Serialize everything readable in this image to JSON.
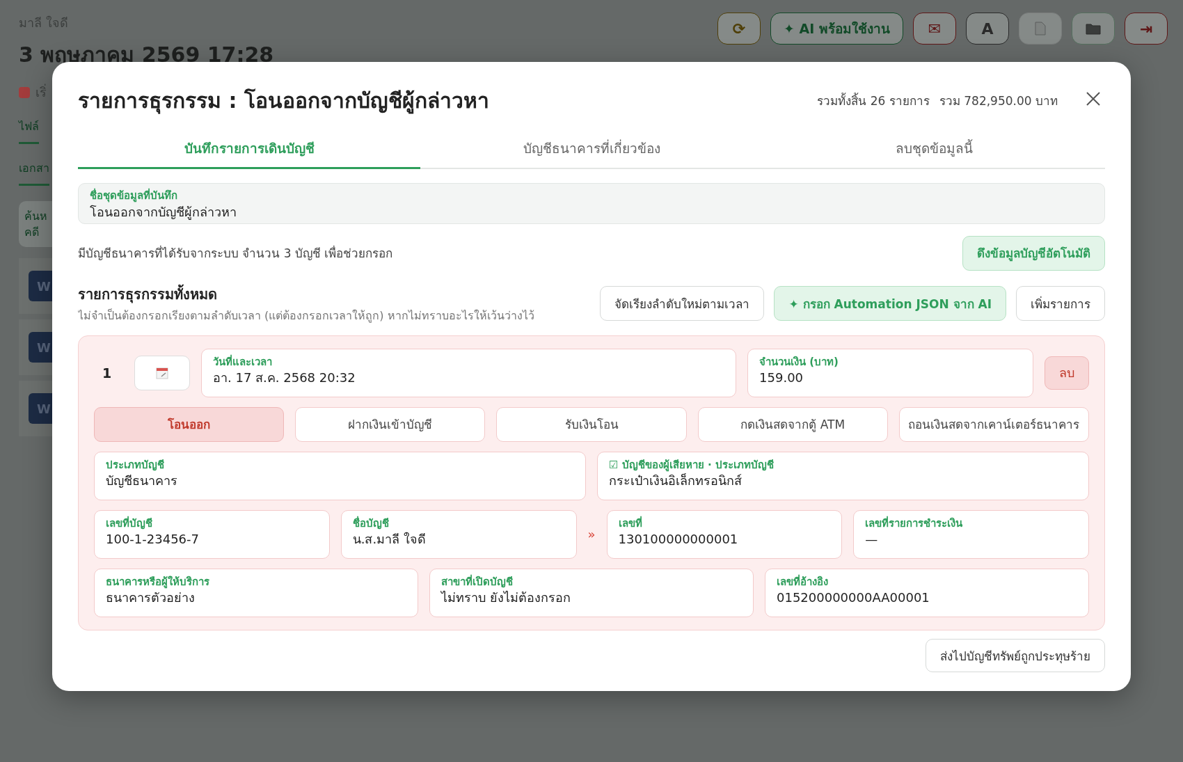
{
  "background": {
    "user_name": "มาลี ใจดี",
    "datetime": "3 พฤษภาคม 2569 17:28",
    "status": {
      "label": "เริ่",
      "color": "#a33c3c"
    },
    "side_tabs": [
      {
        "label": "ไฟล์",
        "selected": true
      },
      {
        "label": "เอกสา",
        "selected": true
      }
    ],
    "search_card": [
      "ค้นห",
      "คดี"
    ],
    "documents": [
      {
        "icon": "W"
      },
      {
        "icon": "W"
      },
      {
        "icon": "W"
      }
    ],
    "toolbar": [
      {
        "kind": "glyph",
        "label": "⟳",
        "color": "#4f3f08"
      },
      {
        "kind": "pill",
        "label": "✦ AI พร้อมใช้งาน",
        "color": "#124a28"
      },
      {
        "kind": "glyph",
        "label": "✉",
        "color": "#5e1616"
      },
      {
        "kind": "glyph",
        "label": "A",
        "color": "#2a2a2a"
      },
      {
        "kind": "document",
        "color": "#7a7d7c"
      },
      {
        "kind": "folder",
        "color": "#55705e"
      },
      {
        "kind": "glyph",
        "label": "⇥",
        "color": "#5e1616"
      }
    ]
  },
  "modal": {
    "title": "รายการธุรกรรม : โอนออกจากบัญชีผู้กล่าวหา",
    "summary": [
      "รวมทั้งสิ้น 26 รายการ",
      "รวม 782,950.00 บาท"
    ],
    "tabs": [
      {
        "label": "บันทึกรายการเดินบัญชี",
        "selected": true
      },
      {
        "label": "บัญชีธนาคารที่เกี่ยวข้อง",
        "selected": false
      },
      {
        "label": "ลบชุดข้อมูลนี้",
        "selected": false
      }
    ],
    "dataset_field": {
      "label": "ชื่อชุดข้อมูลที่บันทึก",
      "value": "โอนออกจากบัญชีผู้กล่าวหา"
    },
    "info_text": "มีบัญชีธนาคารที่ได้รับจากระบบ จำนวน 3 บัญชี เพื่อช่วยกรอก",
    "autofill_button": "ดึงข้อมูลบัญชีอัตโนมัติ",
    "section": {
      "title": "รายการธุรกรรมทั้งหมด",
      "subtitle": "ไม่จำเป็นต้องกรอกเรียงตามลำดับเวลา (แต่ต้องกรอกเวลาให้ถูก) หากไม่ทราบอะไรให้เว้นว่างไว้"
    },
    "actions": [
      {
        "kind": "plain",
        "label": "จัดเรียงลำดับใหม่ตามเวลา"
      },
      {
        "kind": "ai",
        "label": "✦ กรอก Automation JSON จาก AI"
      },
      {
        "kind": "plain",
        "label": "เพิ่มรายการ"
      }
    ],
    "transactions": [
      {
        "number": "1",
        "datetime": {
          "label": "วันที่และเวลา",
          "value": "อา. 17 ส.ค. 2568 20:32"
        },
        "amount": {
          "label": "จำนวนเงิน (บาท)",
          "value": "159.00"
        },
        "delete_label": "ลบ",
        "types": [
          {
            "label": "โอนออก",
            "selected": true
          },
          {
            "label": "ฝากเงินเข้าบัญชี",
            "selected": false
          },
          {
            "label": "รับเงินโอน",
            "selected": false
          },
          {
            "label": "กดเงินสดจากตู้ ATM",
            "selected": false
          },
          {
            "label": "ถอนเงินสดจากเคาน์เตอร์ธนาคาร",
            "selected": false
          }
        ],
        "field_rows": [
          [
            {
              "kind": "field",
              "label": "ประเภทบัญชี",
              "value": "บัญชีธนาคาร"
            },
            {
              "kind": "field",
              "label": "☑ บัญชีของผู้เสียหาย · ประเภทบัญชี",
              "value": "กระเป๋าเงินอิเล็กทรอนิกส์"
            }
          ],
          [
            {
              "kind": "field",
              "label": "เลขที่บัญชี",
              "value": "100-1-23456-7"
            },
            {
              "kind": "field",
              "label": "ชื่อบัญชี",
              "value": "น.ส.มาลี ใจดี"
            },
            {
              "kind": "arrow",
              "label": "»"
            },
            {
              "kind": "field",
              "label": "เลขที่",
              "value": "130100000000001"
            },
            {
              "kind": "field",
              "label": "เลขที่รายการชำระเงิน",
              "value": "—"
            }
          ],
          [
            {
              "kind": "field",
              "label": "ธนาคารหรือผู้ให้บริการ",
              "value": "ธนาคารตัวอย่าง"
            },
            {
              "kind": "field",
              "label": "สาขาที่เปิดบัญชี",
              "value": "ไม่ทราบ ยังไม่ต้องกรอก"
            },
            {
              "kind": "field",
              "label": "เลขที่อ้างอิง",
              "value": "015200000000AA00001"
            }
          ]
        ]
      }
    ],
    "footer_button": "ส่งไปบัญชีทรัพย์ถูกประทุษร้าย"
  }
}
